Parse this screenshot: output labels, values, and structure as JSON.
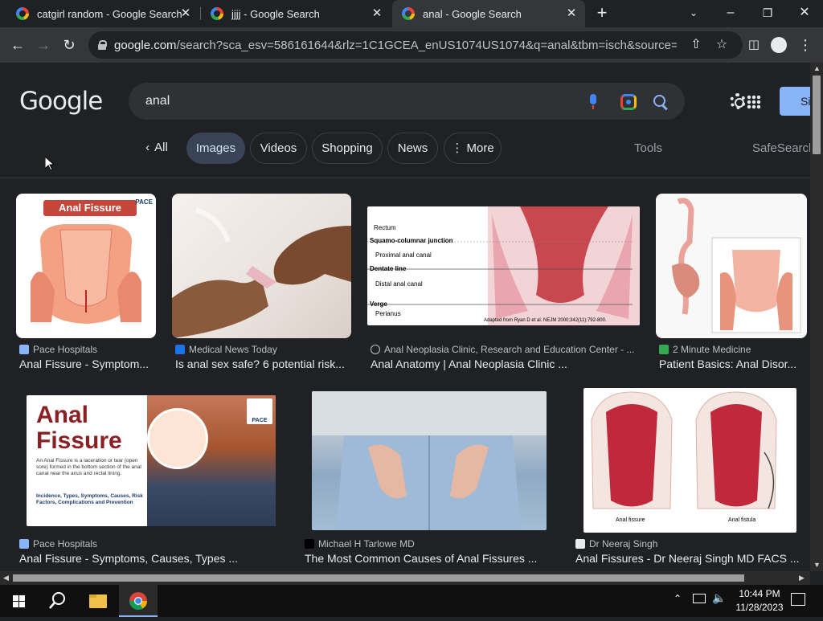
{
  "browser": {
    "tabs": [
      {
        "title": "catgirl random - Google Search",
        "close": "✕"
      },
      {
        "title": "jjjj - Google Search",
        "close": "✕"
      },
      {
        "title": "anal - Google Search",
        "close": "✕"
      }
    ],
    "new_tab": "+",
    "url_host": "google.com",
    "url_rest": "/search?sca_esv=586161644&rlz=1C1GCEA_enUS1074US1074&q=anal&tbm=isch&source=lnms&s..."
  },
  "google": {
    "logo": "Google",
    "query": "anal",
    "signin_label": "Si",
    "chips": [
      "All",
      "Images",
      "Videos",
      "Shopping",
      "News",
      "More"
    ],
    "tools": "Tools",
    "safesearch": "SafeSearch"
  },
  "results": [
    {
      "source": "Pace Hospitals",
      "title": "Anal Fissure - Symptom...",
      "thumb_heading": "Anal Fissure",
      "thumb_brand": "PACE"
    },
    {
      "source": "Medical News Today",
      "title": "Is anal sex safe? 6 potential risk..."
    },
    {
      "source": "Anal Neoplasia Clinic, Research and Education Center - ...",
      "title": "Anal Anatomy | Anal Neoplasia Clinic ...",
      "labels": [
        "Rectum",
        "Squamo-columnar junction",
        "Proximal anal canal",
        "Dentate line",
        "Distal anal canal",
        "Verge",
        "Perianus"
      ],
      "caption": "Adapted from Ryan D et al. NEJM 2000;342(11):792-800."
    },
    {
      "source": "2 Minute Medicine",
      "title": "Patient Basics: Anal Disor..."
    },
    {
      "source": "Pace Hospitals",
      "title": "Anal Fissure - Symptoms, Causes, Types ...",
      "thumb_heading_1": "Anal",
      "thumb_heading_2": "Fissure",
      "thumb_brand": "PACE",
      "thumb_body": "An Anal Fissure is a laceration or tear (open sore) formed in the bottom section of the anal canal near the anus and rectal lining.",
      "thumb_sub": "Incidence, Types, Symptoms, Causes, Risk Factors, Complications and Prevention"
    },
    {
      "source": "Michael H Tarlowe MD",
      "title": "The Most Common Causes of Anal Fissures ..."
    },
    {
      "source": "Dr Neeraj Singh",
      "title": "Anal Fissures - Dr Neeraj Singh MD FACS ...",
      "label_left": "Anal fissure",
      "label_right": "Anal fistula"
    }
  ],
  "taskbar": {
    "time": "10:44 PM",
    "date": "11/28/2023"
  },
  "colors": {
    "page_bg": "#202124",
    "accent_blue": "#8ab4f8",
    "selected_chip": "#394457"
  }
}
